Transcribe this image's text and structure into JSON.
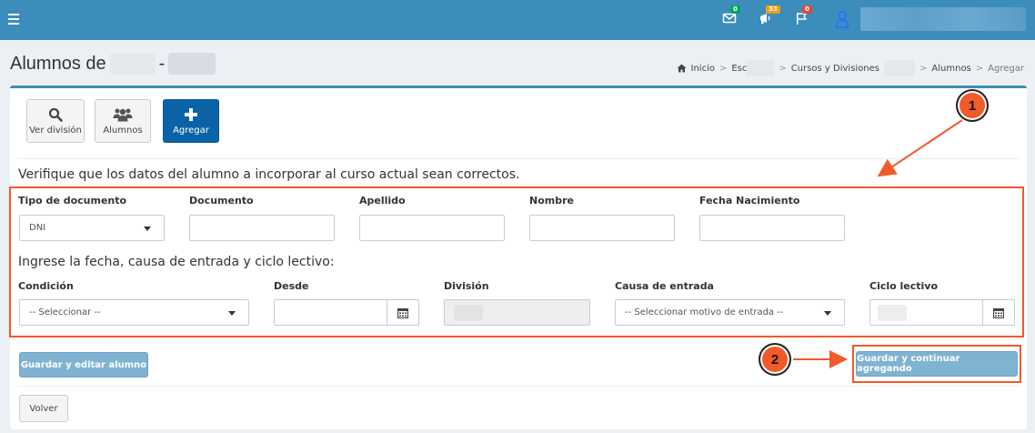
{
  "nav": {
    "badges": {
      "mail": "0",
      "announce": "33",
      "flag": "0"
    }
  },
  "header": {
    "title": "Alumnos de",
    "title_sep": "-"
  },
  "breadcrumb": {
    "home": "Inicio",
    "escuela": "Esc",
    "cursos": "Cursos y Divisiones",
    "alumnos": "Alumnos",
    "current": "Agregar"
  },
  "toolbar": {
    "ver_division": "Ver división",
    "alumnos": "Alumnos",
    "agregar": "Agregar"
  },
  "form": {
    "intro": "Verifique que los datos del alumno a incorporar al curso actual sean correctos.",
    "tipo_documento_label": "Tipo de documento",
    "tipo_documento_value": "DNI",
    "documento_label": "Documento",
    "apellido_label": "Apellido",
    "nombre_label": "Nombre",
    "fecha_nacimiento_label": "Fecha Nacimiento",
    "section2_intro": "Ingrese la fecha, causa de entrada y ciclo lectivo:",
    "condicion_label": "Condición",
    "condicion_value": "-- Seleccionar --",
    "desde_label": "Desde",
    "division_label": "División",
    "causa_label": "Causa de entrada",
    "causa_value": "-- Seleccionar motivo de entrada --",
    "ciclo_label": "Ciclo lectivo"
  },
  "actions": {
    "guardar_editar": "Guardar y editar alumno",
    "guardar_continuar": "Guardar y continuar agregando",
    "volver": "Volver"
  },
  "annotations": {
    "marker1": "1",
    "marker2": "2",
    "color": "#f25a29"
  },
  "colors": {
    "topbar": "#3c8dbc",
    "primary_button": "#0a63a6",
    "light_button": "#80b3d2"
  }
}
